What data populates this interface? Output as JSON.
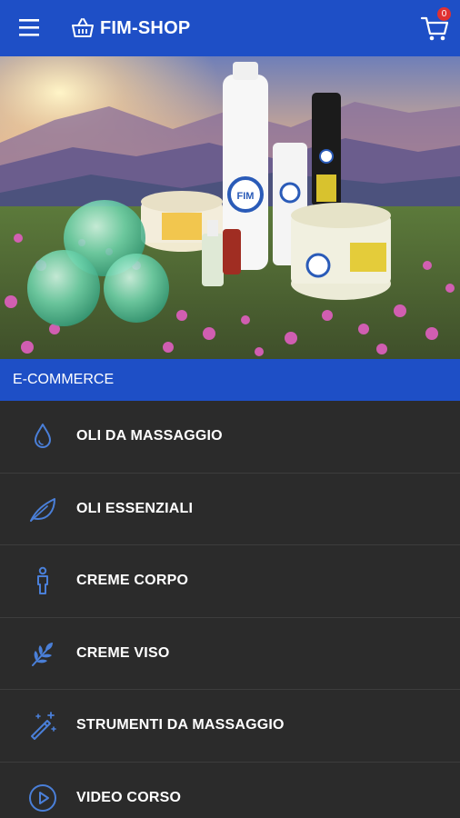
{
  "appbar": {
    "title": "FIM-SHOP",
    "cart_count": "0",
    "menu_icon": "hamburger-menu-icon",
    "brand_icon": "basket-icon",
    "cart_icon": "shopping-cart-icon"
  },
  "hero": {
    "image": "promotional banner with massage oil bottles, creams and glass cupping cups in a mountain flower meadow at sunset"
  },
  "section": {
    "title": "E-COMMERCE"
  },
  "menu": [
    {
      "label": "OLI DA MASSAGGIO",
      "icon": "water-drop-icon"
    },
    {
      "label": "OLI ESSENZIALI",
      "icon": "leaf-icon"
    },
    {
      "label": "CREME CORPO",
      "icon": "person-icon"
    },
    {
      "label": "CREME VISO",
      "icon": "plant-sprig-icon"
    },
    {
      "label": "STRUMENTI DA MASSAGGIO",
      "icon": "magic-wand-icon"
    },
    {
      "label": "VIDEO CORSO",
      "icon": "play-circle-icon"
    }
  ],
  "colors": {
    "primary": "#1e4fc6",
    "background": "#2b2b2b",
    "icon": "#4a7fd8",
    "badge": "#e03131"
  }
}
